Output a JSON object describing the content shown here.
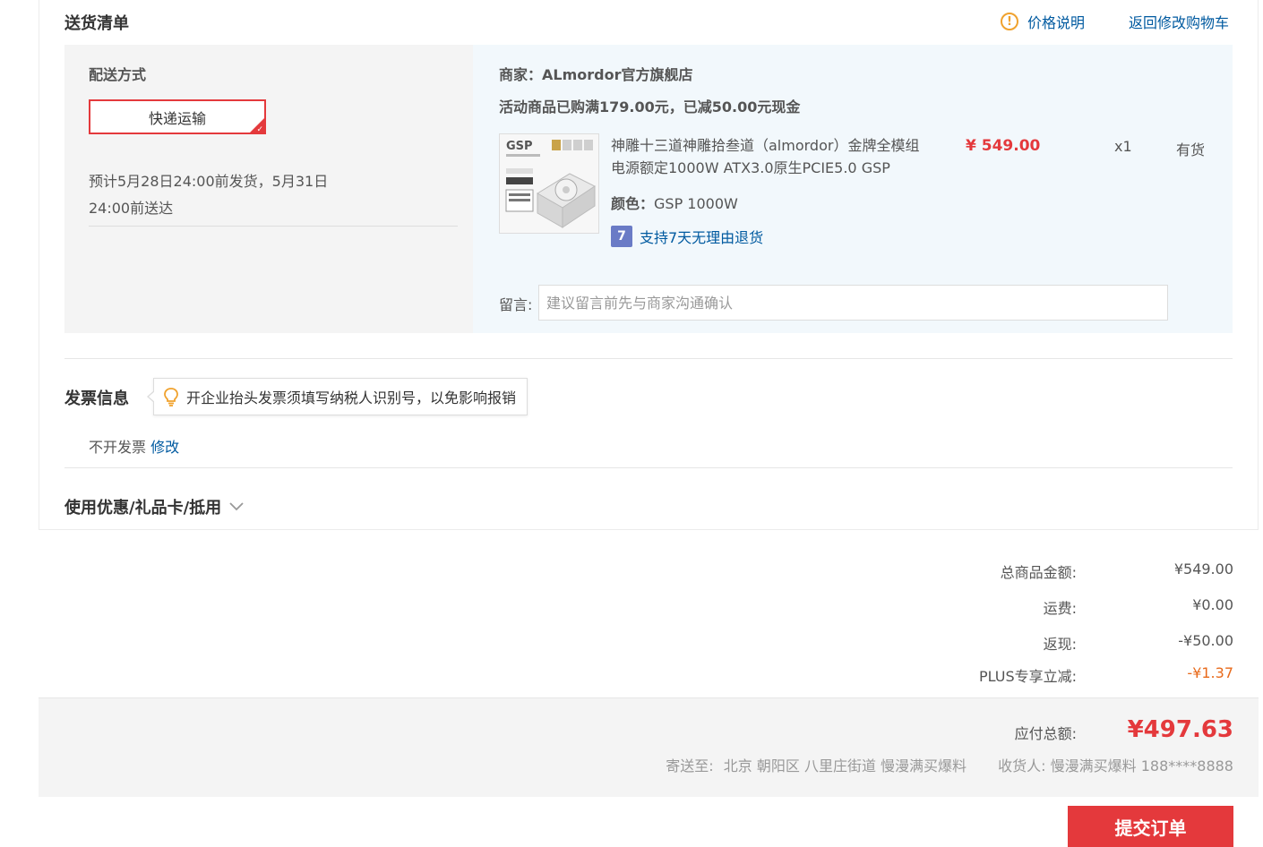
{
  "header": {
    "title": "送货清单",
    "price_note": "价格说明",
    "back_to_cart": "返回修改购物车"
  },
  "shipping": {
    "label": "配送方式",
    "method": "快递运输",
    "estimate": "预计5月28日24:00前发货，5月31日24:00前送达"
  },
  "shop": {
    "name": "商家：ALmordor官方旗舰店",
    "promo": "活动商品已购满179.00元，已减50.00元现金"
  },
  "product": {
    "name": "神雕十三道神雕拾叁道（almordor）金牌全模组电源额定1000W ATX3.0原生PCIE5.0 GSP",
    "color_label": "颜色：",
    "color_value": "GSP 1000W",
    "return_policy": "支持7天无理由退货",
    "return_icon_text": "7",
    "price": "¥ 549.00",
    "quantity": "x1",
    "stock": "有货",
    "image_label": "GSP"
  },
  "remark": {
    "label": "留言:",
    "placeholder": "建议留言前先与商家沟通确认"
  },
  "invoice": {
    "title": "发票信息",
    "tip": "开企业抬头发票须填写纳税人识别号，以免影响报销",
    "status": "不开发票",
    "edit": "修改"
  },
  "coupon": {
    "title": "使用优惠/礼品卡/抵用"
  },
  "summary": {
    "rows": [
      {
        "label": "总商品金额:",
        "value": "¥549.00"
      },
      {
        "label": "运费:",
        "value": "¥0.00"
      },
      {
        "label": "返现:",
        "value": "-¥50.00"
      },
      {
        "label": "PLUS专享立减:",
        "value": "-¥1.37"
      }
    ],
    "total_label": "应付总额:",
    "total_value": "¥497.63",
    "ship_to_label": "寄送至:",
    "address": "北京 朝阳区 八里庄街道 慢漫满买爆料",
    "receiver_label": "收货人:",
    "receiver": "慢漫满买爆料 188****8888"
  },
  "submit": {
    "label": "提交订单"
  },
  "colors": {
    "accent_red": "#e4393c",
    "link_blue": "#005aa0",
    "plus_discount": "#e86a1b"
  }
}
